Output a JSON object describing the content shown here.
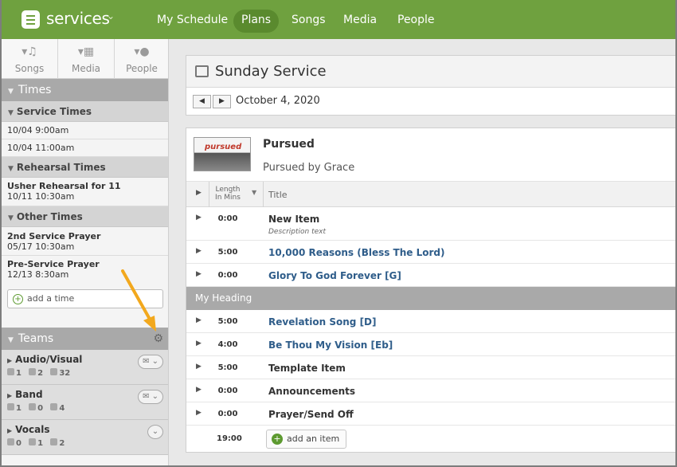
{
  "nav": {
    "brand": "services",
    "items": [
      {
        "label": "My Schedule"
      },
      {
        "label": "Plans"
      },
      {
        "label": "Songs"
      },
      {
        "label": "Media"
      },
      {
        "label": "People"
      }
    ],
    "active": "Plans"
  },
  "sidebar": {
    "tabs": [
      {
        "label": "Songs"
      },
      {
        "label": "Media"
      },
      {
        "label": "People"
      }
    ],
    "times_heading": "Times",
    "service_times_heading": "Service Times",
    "service_times": [
      "10/04 9:00am",
      "10/04 11:00am"
    ],
    "rehearsal_heading": "Rehearsal Times",
    "rehearsal": [
      {
        "name": "Usher Rehearsal for 11",
        "date": "10/11 10:30am"
      }
    ],
    "other_heading": "Other Times",
    "other": [
      {
        "name": "2nd Service Prayer",
        "date": "05/17 10:30am"
      },
      {
        "name": "Pre-Service Prayer",
        "date": "12/13 8:30am"
      }
    ],
    "add_time": "add a time",
    "teams_heading": "Teams",
    "teams": [
      {
        "name": "Audio/Visual",
        "c1": "1",
        "c2": "2",
        "c3": "32"
      },
      {
        "name": "Band",
        "c1": "1",
        "c2": "0",
        "c3": "4"
      },
      {
        "name": "Vocals",
        "c1": "0",
        "c2": "1",
        "c3": "2"
      }
    ]
  },
  "plan": {
    "title": "Sunday Service",
    "date": "October 4, 2020"
  },
  "song": {
    "thumb_text": "pursued",
    "title": "Pursued",
    "subtitle": "Pursued by Grace"
  },
  "columns": {
    "length": "Length In Mins",
    "title": "Title"
  },
  "items": [
    {
      "length": "0:00",
      "title": "New Item",
      "desc": "Description text",
      "song": false
    },
    {
      "length": "5:00",
      "title": "10,000 Reasons (Bless The Lord)",
      "song": true
    },
    {
      "length": "0:00",
      "title": "Glory To God Forever [G]",
      "song": true
    }
  ],
  "heading": "My Heading",
  "items2": [
    {
      "length": "5:00",
      "title": "Revelation Song [D]",
      "song": true
    },
    {
      "length": "4:00",
      "title": "Be Thou My Vision [Eb]",
      "song": true
    },
    {
      "length": "5:00",
      "title": "Template Item",
      "song": false
    },
    {
      "length": "0:00",
      "title": "Announcements",
      "song": false
    },
    {
      "length": "0:00",
      "title": "Prayer/Send Off",
      "song": false
    }
  ],
  "total": "19:00",
  "add_item": "add an item",
  "colors": {
    "brand": "#6fa13f",
    "accent_arrow": "#f2a81d",
    "song_link": "#2f5d8a"
  }
}
